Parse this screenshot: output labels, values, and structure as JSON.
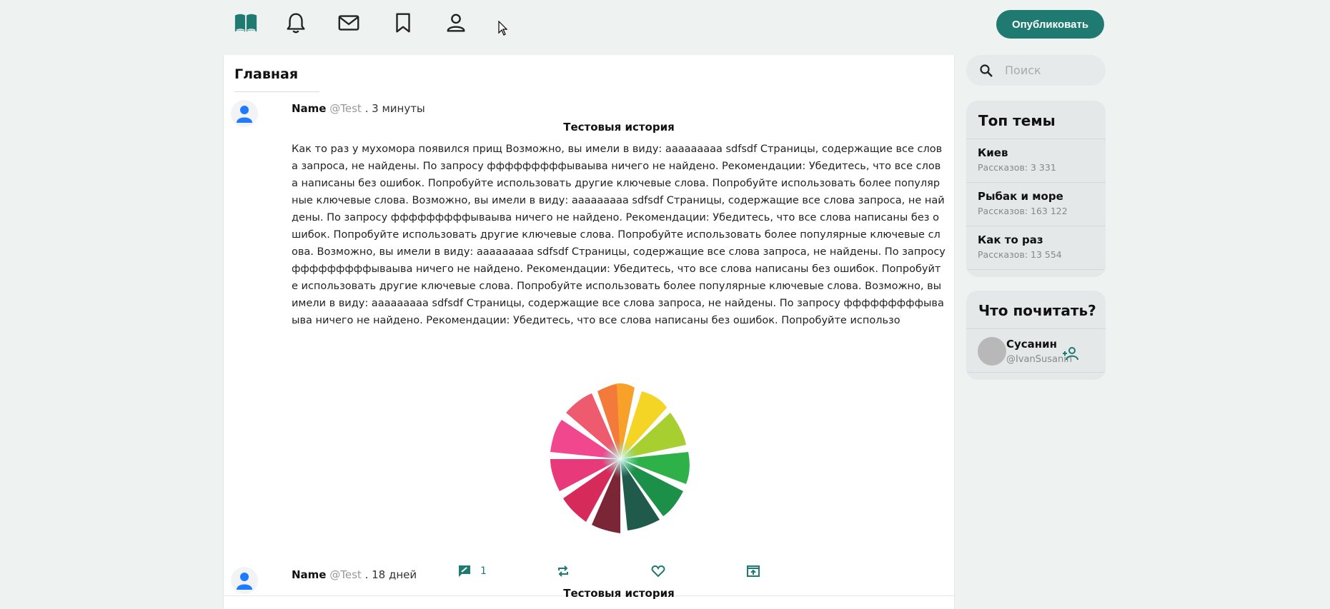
{
  "nav": {
    "icons": [
      "book-icon",
      "bell-icon",
      "mail-icon",
      "bookmark-icon",
      "user-icon"
    ],
    "publish_label": "Опубликовать"
  },
  "colors": {
    "accent": "#1f7a72",
    "background": "#eef2f1"
  },
  "main": {
    "title": "Главная",
    "posts": [
      {
        "name": "Name",
        "handle": "@Test",
        "time": ". 3 минуты",
        "title": "Тестовыя история",
        "body": "Как то раз у мухомора появился прищ Возможно, вы имели в виду: ааааааааа sdfsdf Страницы, содержащие все слова запроса, не найдены. По запросу фффффффффываыва ничего не найдено. Рекомендации: Убедитесь, что все слова написаны без ошибок. Попробуйте использовать другие ключевые слова. Попробуйте использовать более популярные ключевые слова. Возможно, вы имели в виду: ааааааааа sdfsdf Страницы, содержащие все слова запроса, не найдены. По запросу фффффффффываыва ничего не найдено. Рекомендации: Убедитесь, что все слова написаны без ошибок. Попробуйте использовать другие ключевые слова. Попробуйте использовать более популярные ключевые слова. Возможно, вы имели в виду: ааааааааа sdfsdf Страницы, содержащие все слова запроса, не найдены. По запросу фффффффффываыва ничего не найдено. Рекомендации: Убедитесь, что все слова написаны без ошибок. Попробуйте использовать другие ключевые слова. Попробуйте использовать более популярные ключевые слова. Возможно, вы имели в виду: ааааааааа sdfsdf Страницы, содержащие все слова запроса, не найдены. По запросу фффффффффываыва ничего не найдено. Рекомендации: Убедитесь, что все слова написаны без ошибок. Попробуйте использо",
        "comments": "1"
      },
      {
        "name": "Name",
        "handle": "@Test",
        "time": ". 18 дней",
        "title": "Тестовыя история"
      }
    ]
  },
  "sidebar": {
    "search_placeholder": "Поиск",
    "topics_title": "Топ темы",
    "topics": [
      {
        "name": "Киев",
        "count": "Рассказов: 3 331"
      },
      {
        "name": "Рыбак и море",
        "count": "Рассказов: 163 122"
      },
      {
        "name": "Как то раз",
        "count": "Рассказов: 13 554"
      }
    ],
    "reads_title": "Что почитать?",
    "suggestions": [
      {
        "name": "Сусанин",
        "handle": "@IvanSusanin"
      }
    ]
  }
}
